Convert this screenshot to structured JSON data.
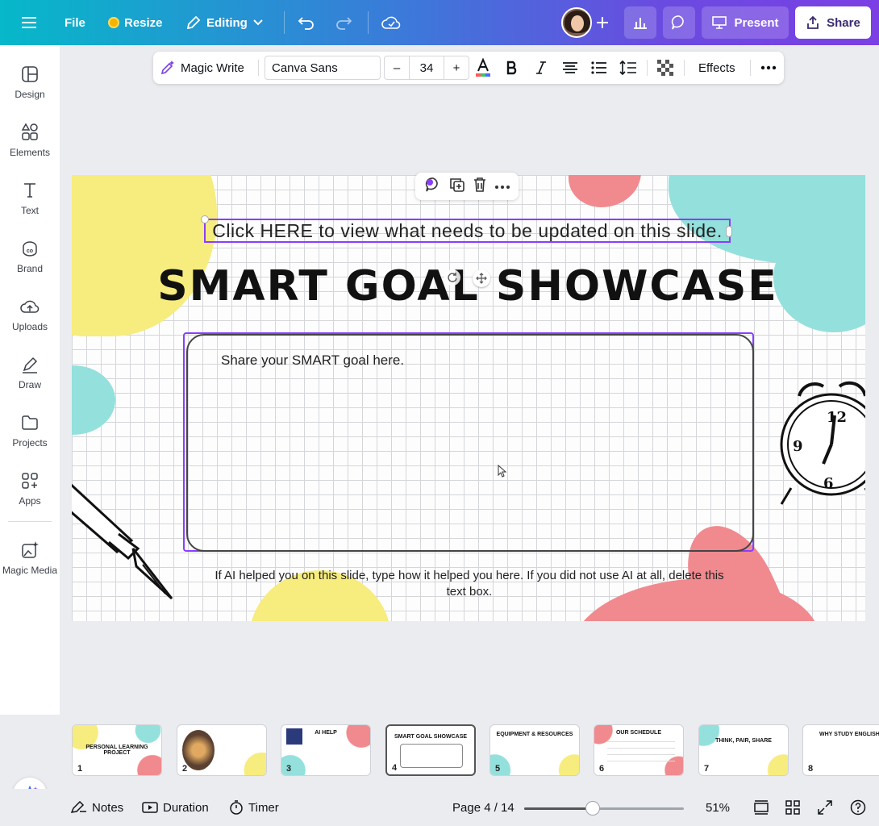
{
  "topbar": {
    "file_label": "File",
    "resize_label": "Resize",
    "editing_label": "Editing",
    "present_label": "Present",
    "share_label": "Share"
  },
  "sidebar": {
    "items": [
      {
        "label": "Design",
        "icon": "design-icon"
      },
      {
        "label": "Elements",
        "icon": "elements-icon"
      },
      {
        "label": "Text",
        "icon": "text-icon"
      },
      {
        "label": "Brand",
        "icon": "brand-icon"
      },
      {
        "label": "Uploads",
        "icon": "uploads-icon"
      },
      {
        "label": "Draw",
        "icon": "draw-icon"
      },
      {
        "label": "Projects",
        "icon": "projects-icon"
      },
      {
        "label": "Apps",
        "icon": "apps-icon"
      },
      {
        "label": "Magic Media",
        "icon": "magic-media-icon"
      }
    ]
  },
  "text_toolbar": {
    "magic_write_label": "Magic Write",
    "font_name": "Canva Sans",
    "font_size": "34",
    "minus": "–",
    "plus": "+",
    "effects_label": "Effects"
  },
  "slide": {
    "click_here_text": "Click HERE to view what needs to be updated on this slide.",
    "title": "SMART GOAL SHOWCASE",
    "goal_prompt": "Share your SMART goal here.",
    "ai_note": "If AI helped you on this slide, type how it helped you here.  If you did not use AI at all, delete this text box."
  },
  "thumbnails": [
    {
      "num": "1",
      "title": "PERSONAL LEARNING PROJECT"
    },
    {
      "num": "2",
      "title": ""
    },
    {
      "num": "3",
      "title": "AI HELP"
    },
    {
      "num": "4",
      "title": "SMART GOAL SHOWCASE"
    },
    {
      "num": "5",
      "title": "EQUIPMENT & RESOURCES"
    },
    {
      "num": "6",
      "title": "OUR SCHEDULE"
    },
    {
      "num": "7",
      "title": "THINK, PAIR, SHARE"
    },
    {
      "num": "8",
      "title": "WHY STUDY ENGLISH"
    }
  ],
  "bottombar": {
    "notes_label": "Notes",
    "duration_label": "Duration",
    "timer_label": "Timer",
    "page_label": "Page 4 / 14",
    "zoom_label": "51%",
    "zoom_fraction": 0.43
  },
  "colors": {
    "accent": "#8b3dff",
    "blob_yellow": "#f7ec7e",
    "blob_teal": "#94e0dc",
    "blob_pink": "#f08a8e"
  }
}
